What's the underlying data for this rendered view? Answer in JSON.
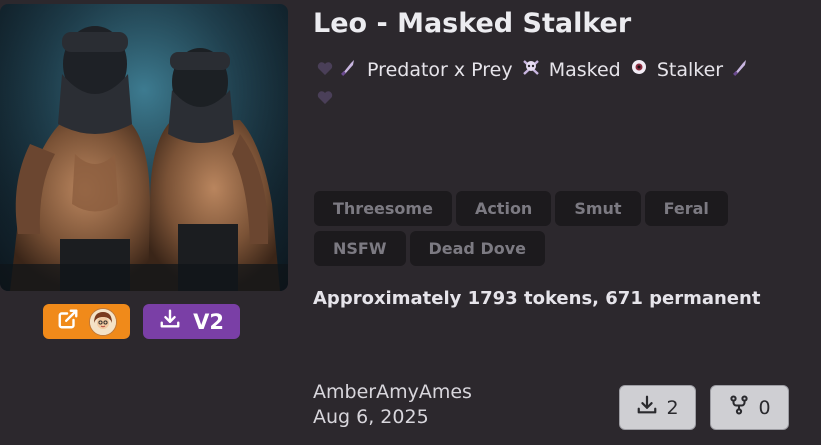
{
  "bot": {
    "title": "Leo - Masked Stalker",
    "tagline": {
      "icons": [
        "purple-heart-icon",
        "knife-icon",
        "skull-crossbones-icon",
        "eye-icon",
        "knife-icon",
        "purple-heart-icon"
      ],
      "part1": "Predator x Prey",
      "part2": "Masked",
      "part3": "Stalker"
    },
    "tags": [
      "Threesome",
      "Action",
      "Smut",
      "Feral",
      "NSFW",
      "Dead Dove"
    ],
    "tokens_text": "Approximately 1793 tokens, 671 permanent",
    "author": "AmberAmyAmes",
    "date": "Aug 6, 2025",
    "version_label": "V2"
  },
  "stats": {
    "downloads": "2",
    "forks": "0"
  },
  "colors": {
    "background": "#2c282d",
    "open_button": "#f08a1a",
    "download_button": "#7a3fa6",
    "tag_bg": "#1c1a1d",
    "tag_text": "#7c7a82",
    "stat_button": "#cfcfd3"
  }
}
